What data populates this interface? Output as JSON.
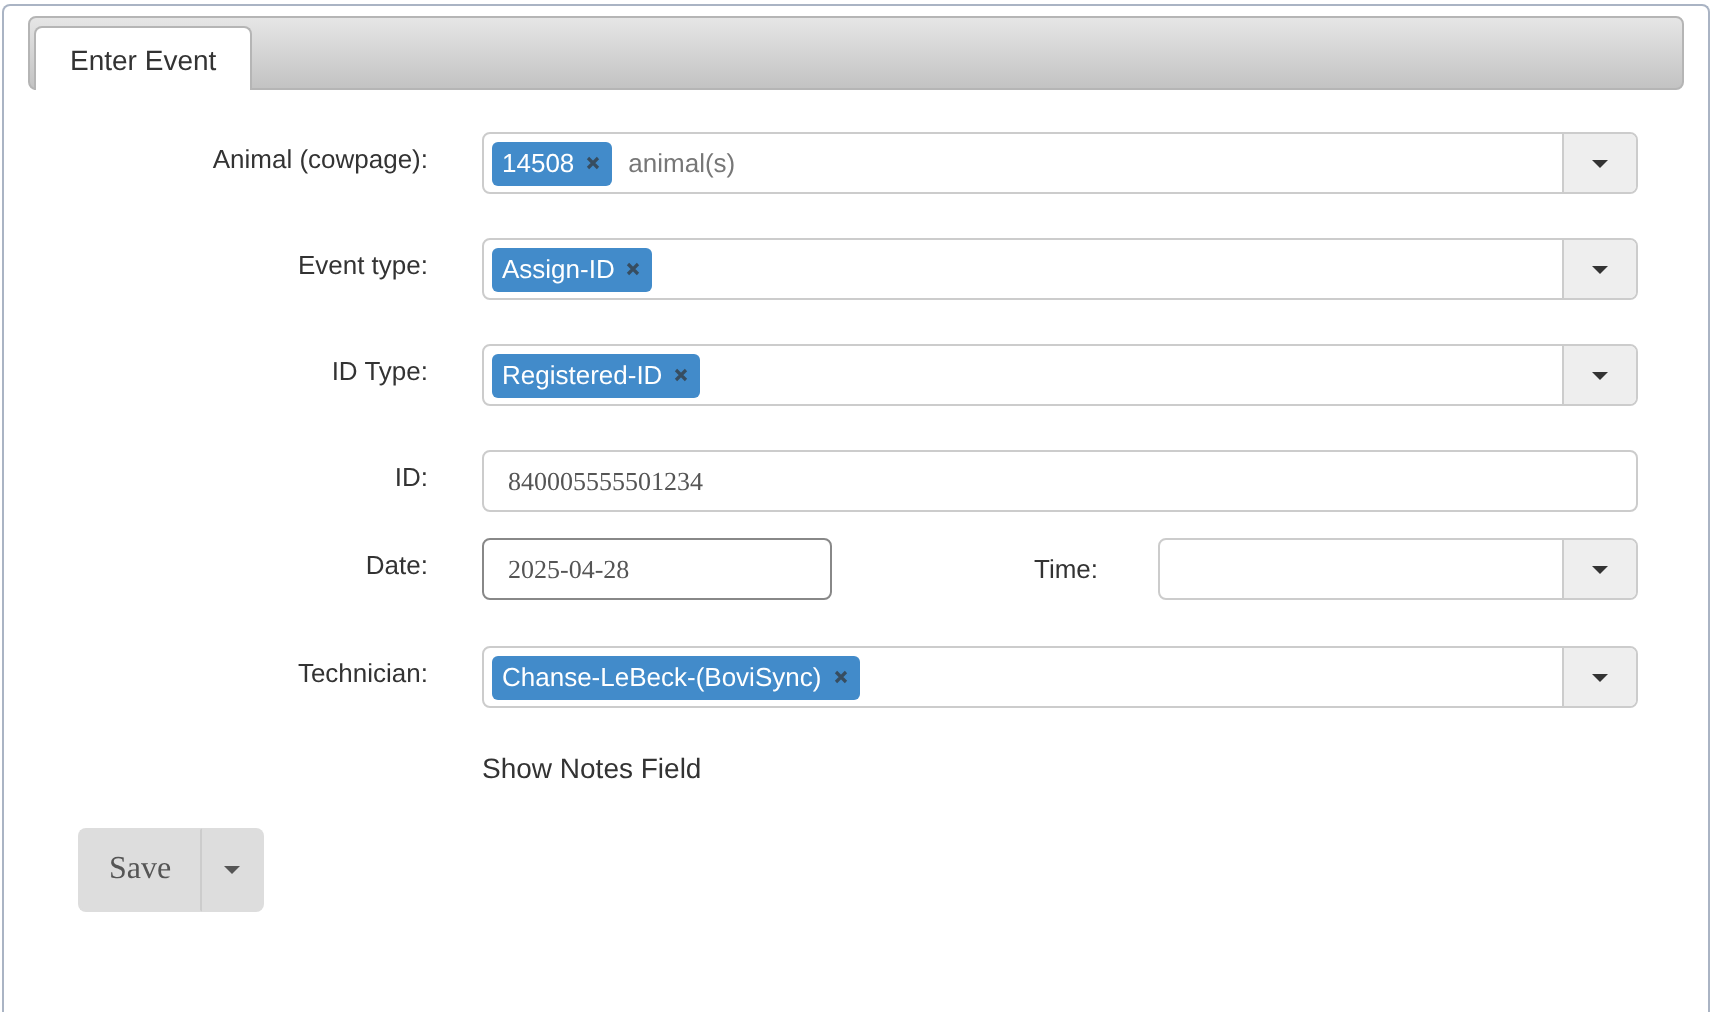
{
  "tabs": [
    {
      "label": "Enter Event",
      "selected": true
    }
  ],
  "fields": [
    {
      "kind": "tags",
      "label": "Animal (cowpage):",
      "tags": [
        "14508"
      ],
      "placeholder": "animal(s)"
    },
    {
      "kind": "tags",
      "label": "Event type:",
      "tags": [
        "Assign-ID"
      ]
    },
    {
      "kind": "tags",
      "label": "ID Type:",
      "tags": [
        "Registered-ID"
      ]
    },
    {
      "kind": "text",
      "label": "ID:",
      "value": "840005555501234"
    },
    {
      "kind": "datetime",
      "label": "Date:",
      "value": "2025-04-28",
      "time_label": "Time:"
    },
    {
      "kind": "tags",
      "label": "Technician:",
      "tags": [
        "Chanse-LeBeck-(BoviSync)"
      ]
    }
  ],
  "notes_link": "Show Notes Field",
  "save_button": "Save"
}
